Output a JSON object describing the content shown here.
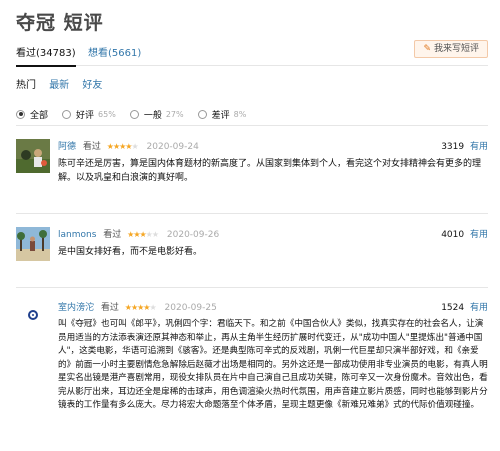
{
  "page": {
    "title": "夺冠 短评"
  },
  "tabs": [
    {
      "label": "看过(34783)"
    },
    {
      "label": "想看(5661)"
    }
  ],
  "write_button": {
    "label": "我来写短评",
    "icon": "pen-icon"
  },
  "sort": {
    "items": [
      "热门",
      "最新",
      "好友"
    ]
  },
  "filter": {
    "options": [
      {
        "label": "全部",
        "pct": "",
        "selected": true
      },
      {
        "label": "好评",
        "pct": "65%",
        "selected": false
      },
      {
        "label": "一般",
        "pct": "27%",
        "selected": false
      },
      {
        "label": "差评",
        "pct": "8%",
        "selected": false
      }
    ]
  },
  "reviews": [
    {
      "user": "阿德",
      "status": "看过",
      "stars": 4,
      "date": "2020-09-24",
      "votes": "3319",
      "useful_label": "有用",
      "text": "陈可辛还是厉害，算是国内体育题材的新高度了。从国家到集体到个人，看完这个对女排精神会有更多的理解。以及巩皇和白浪演的真好啊。"
    },
    {
      "user": "lanmons",
      "status": "看过",
      "stars": 3,
      "date": "2020-09-26",
      "votes": "4010",
      "useful_label": "有用",
      "text": "是中国女排好看，而不是电影好看。"
    },
    {
      "user": "室内滂沱",
      "status": "看过",
      "stars": 4,
      "date": "2020-09-25",
      "votes": "1524",
      "useful_label": "有用",
      "text": "叫《夺冠》也可叫《郎平》，巩俐四个字：君临天下。和之前《中国合伙人》类似，找真实存在的社会名人，让演员用适当的方法添表演还原其神态和举止，再从主角半生经历扩展时代变迁，从\"成功中国人\"里提炼出\"普通中国人\"，这类电影，华语可追溯到《骇客》。还是典型陈可辛式的反戏剧，巩俐一代巨星却只演半部好戏，和《亲爱的》前面一小时主要剧情危急解除后赵薇才出场是相同的。另外这还是一部成功使用非专业演员的电影，有真人明星实名出镜是港产喜剧常用，现役女排队员在片中自己演自己且成功关键，陈可辛又一次身份魔术。音效出色，看完从影厅出来，耳边还全是扉稀的击球声，用色调渲染火热时代氛围，用声音建立影片质感，同时也能够到影片分镜表的工作量有多么庞大。尽力将宏大命题落至个体矛盾，呈现主题更像《新难兄难弟》式的代际价值观碰撞。"
    }
  ]
}
